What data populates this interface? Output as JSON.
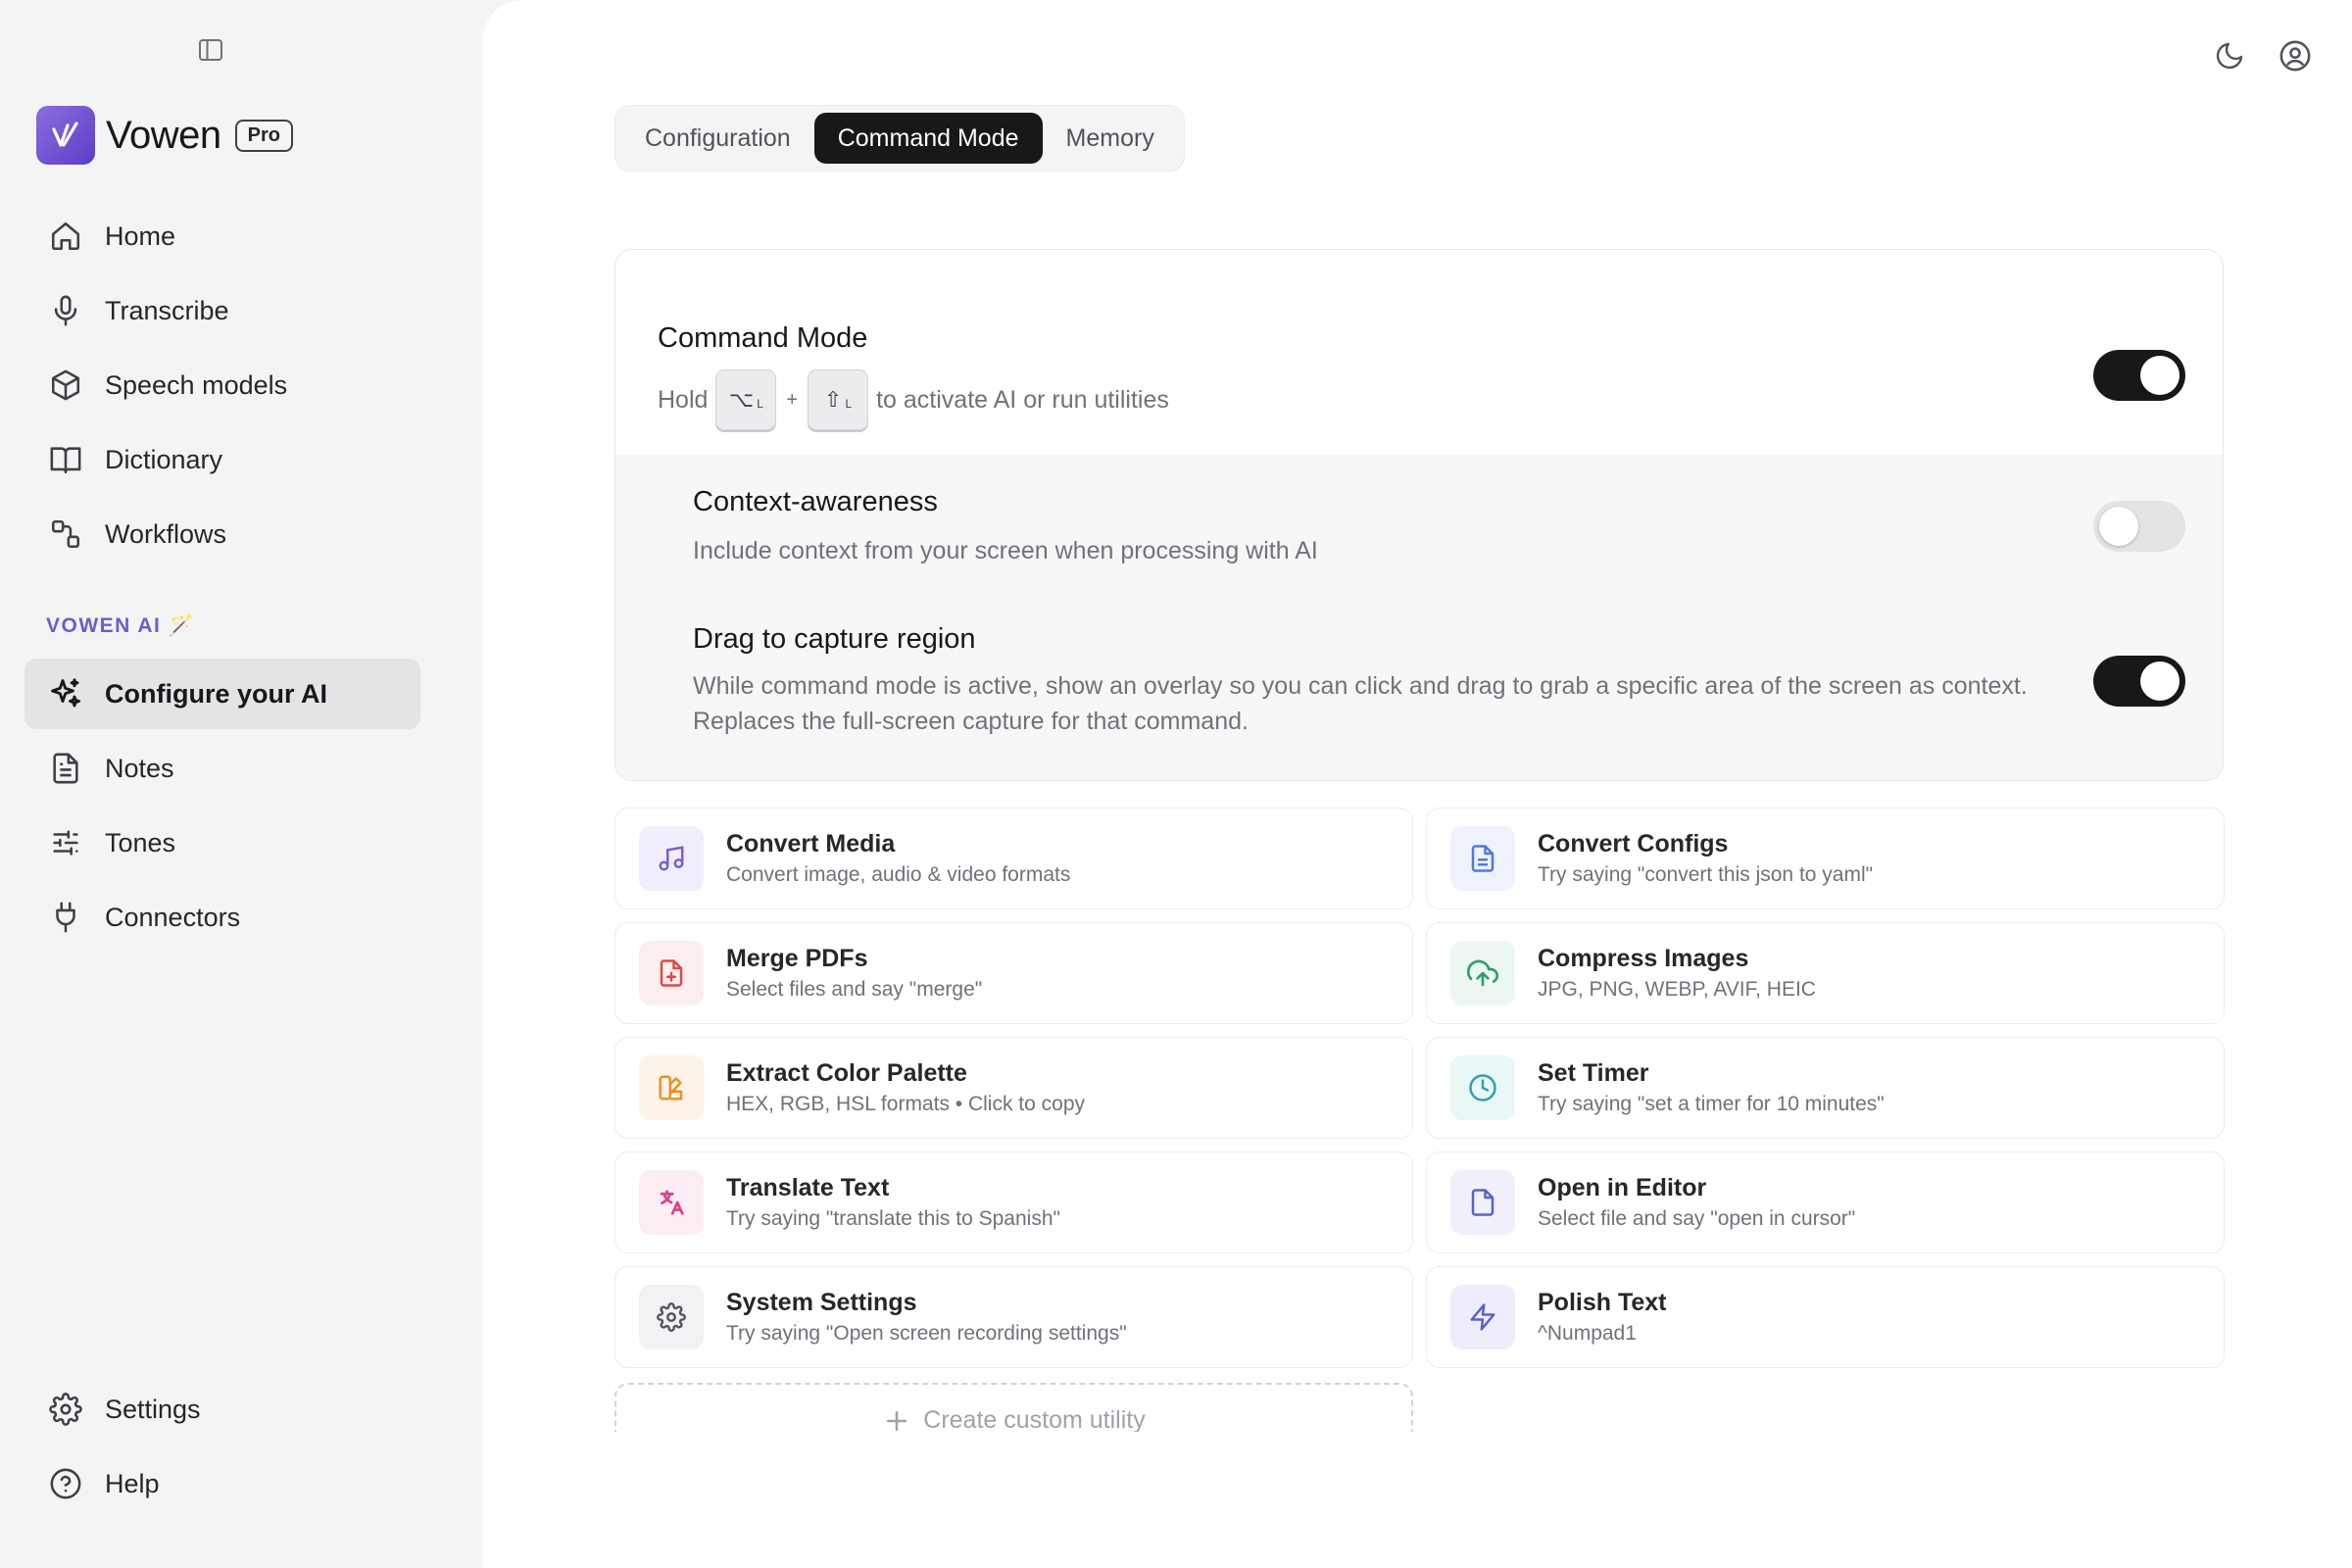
{
  "sidebar": {
    "brand": {
      "name": "Vowen",
      "badge": "Pro"
    },
    "items": [
      {
        "label": "Home",
        "icon": "home-icon"
      },
      {
        "label": "Transcribe",
        "icon": "microphone-icon"
      },
      {
        "label": "Speech models",
        "icon": "cube-icon"
      },
      {
        "label": "Dictionary",
        "icon": "book-icon"
      },
      {
        "label": "Workflows",
        "icon": "workflow-icon"
      }
    ],
    "section_label": "VOWEN AI 🪄",
    "ai_items": [
      {
        "label": "Configure your AI",
        "icon": "sparkles-icon",
        "active": true
      },
      {
        "label": "Notes",
        "icon": "notes-icon"
      },
      {
        "label": "Tones",
        "icon": "sliders-icon"
      },
      {
        "label": "Connectors",
        "icon": "plug-icon"
      }
    ],
    "footer_items": [
      {
        "label": "Settings",
        "icon": "gear-icon"
      },
      {
        "label": "Help",
        "icon": "help-icon"
      }
    ]
  },
  "tabs": [
    {
      "label": "Configuration",
      "active": false
    },
    {
      "label": "Command Mode",
      "active": true
    },
    {
      "label": "Memory",
      "active": false
    }
  ],
  "command_mode": {
    "title": "Command Mode",
    "hold_prefix": "Hold",
    "key1": "⌥",
    "key1_sub": "L",
    "plus": "+",
    "key2": "⇧",
    "key2_sub": "L",
    "hold_suffix": "to activate AI or run utilities",
    "enabled": true
  },
  "context_awareness": {
    "title": "Context-awareness",
    "desc": "Include context from your screen when processing with AI",
    "enabled": false
  },
  "drag_capture": {
    "title": "Drag to capture region",
    "desc_line1": "While command mode is active, show an overlay so you can click and drag to grab a specific area of the screen as context.",
    "desc_line2": "Replaces the full-screen capture for that command.",
    "enabled": true
  },
  "utilities": [
    {
      "title": "Convert Media",
      "subtitle": "Convert image, audio & video formats",
      "icon": "music-icon",
      "color": "#7c5cd6",
      "bg": "#f1eefb"
    },
    {
      "title": "Convert Configs",
      "subtitle": "Try saying \"convert this json to yaml\"",
      "icon": "document-icon",
      "color": "#4f7ad8",
      "bg": "#eef2fb"
    },
    {
      "title": "Merge PDFs",
      "subtitle": "Select files and say \"merge\"",
      "icon": "file-plus-icon",
      "color": "#dc4a4a",
      "bg": "#fdeeee"
    },
    {
      "title": "Compress Images",
      "subtitle": "JPG, PNG, WEBP, AVIF, HEIC",
      "icon": "cloud-upload-icon",
      "color": "#2f9e6a",
      "bg": "#ecf7f1"
    },
    {
      "title": "Extract Color Palette",
      "subtitle": "HEX, RGB, HSL formats • Click to copy",
      "icon": "palette-icon",
      "color": "#e9922a",
      "bg": "#fdf3e8"
    },
    {
      "title": "Set Timer",
      "subtitle": "Try saying \"set a timer for 10 minutes\"",
      "icon": "clock-icon",
      "color": "#2ea5b0",
      "bg": "#ebf6f7"
    },
    {
      "title": "Translate Text",
      "subtitle": "Try saying \"translate this to Spanish\"",
      "icon": "translate-icon",
      "color": "#d8408a",
      "bg": "#fcedf4"
    },
    {
      "title": "Open in Editor",
      "subtitle": "Select file and say \"open in cursor\"",
      "icon": "file-icon",
      "color": "#5a63c8",
      "bg": "#eff0fa"
    },
    {
      "title": "System Settings",
      "subtitle": "Try saying \"Open screen recording settings\"",
      "icon": "gear-icon",
      "color": "#52525b",
      "bg": "#f2f2f4"
    },
    {
      "title": "Polish Text",
      "subtitle": "^Numpad1",
      "icon": "lightning-icon",
      "color": "#5a5fd0",
      "bg": "#eeeefa"
    }
  ],
  "create_custom": {
    "label": "Create custom utility"
  }
}
